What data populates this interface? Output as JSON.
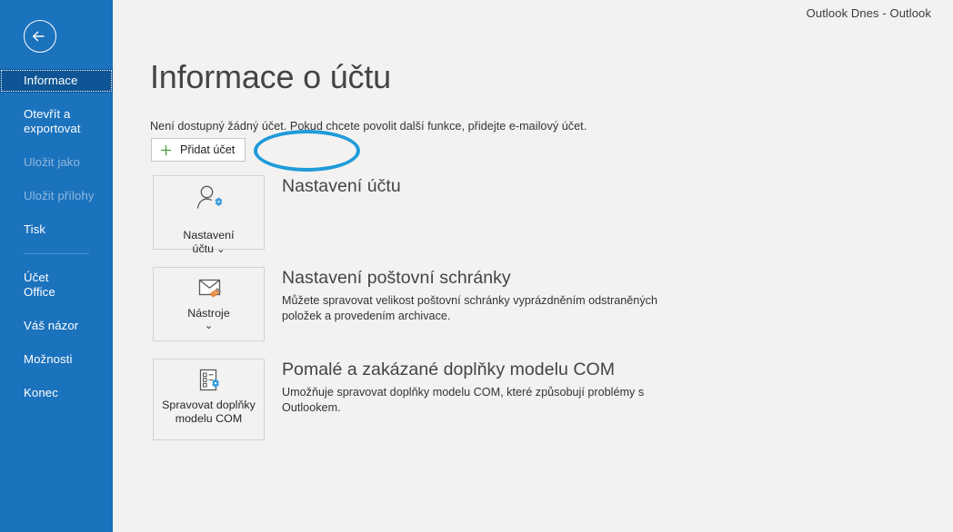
{
  "window": {
    "title_bar": "Outlook Dnes  -  Outlook"
  },
  "colors": {
    "sidebar": "#1b72bd",
    "sidebar_selected": "#0f5494",
    "content_bg": "#f3f2f1",
    "annotation": "#1f9bd8",
    "accent_gear": "#2f9ad8",
    "plus_green": "#3f9c35",
    "broom_orange": "#e8862b"
  },
  "sidebar": {
    "back_button": "back-arrow-icon",
    "items": [
      {
        "label": "Informace",
        "state": "selected"
      },
      {
        "label": "Otevřít a\nexportovat",
        "state": "normal"
      },
      {
        "label": "Uložit jako",
        "state": "disabled"
      },
      {
        "label": "Uložit přílohy",
        "state": "disabled"
      },
      {
        "label": "Tisk",
        "state": "normal"
      },
      {
        "label": "Účet\nOffice",
        "state": "normal"
      },
      {
        "label": "Váš názor",
        "state": "normal"
      },
      {
        "label": "Možnosti",
        "state": "normal"
      },
      {
        "label": "Konec",
        "state": "normal"
      }
    ]
  },
  "main": {
    "page_title": "Informace o účtu",
    "account_notice": "Není dostupný žádný účet. Pokud chcete povolit další funkce, přidejte e-mailový účet.",
    "add_account_button": "Přidat účet",
    "sections": [
      {
        "tile_label": "Nastavení\núčtu",
        "tile_icon": "account-settings-icon",
        "tile_chevron": "inline",
        "heading": "Nastavení účtu",
        "text": ""
      },
      {
        "tile_label": "Nástroje",
        "tile_icon": "mailbox-cleanup-tools-icon",
        "tile_chevron": "below",
        "heading": "Nastavení poštovní schránky",
        "text": "Můžete spravovat velikost poštovní schránky vyprázdněním odstraněných položek a provedením archivace."
      },
      {
        "tile_label": "Spravovat doplňky\nmodelu COM",
        "tile_icon": "com-addins-icon",
        "tile_chevron": "none",
        "heading": "Pomalé a zakázané doplňky modelu COM",
        "text": "Umožňuje spravovat doplňky modelu COM, které způsobují problémy s Outlookem."
      }
    ]
  }
}
